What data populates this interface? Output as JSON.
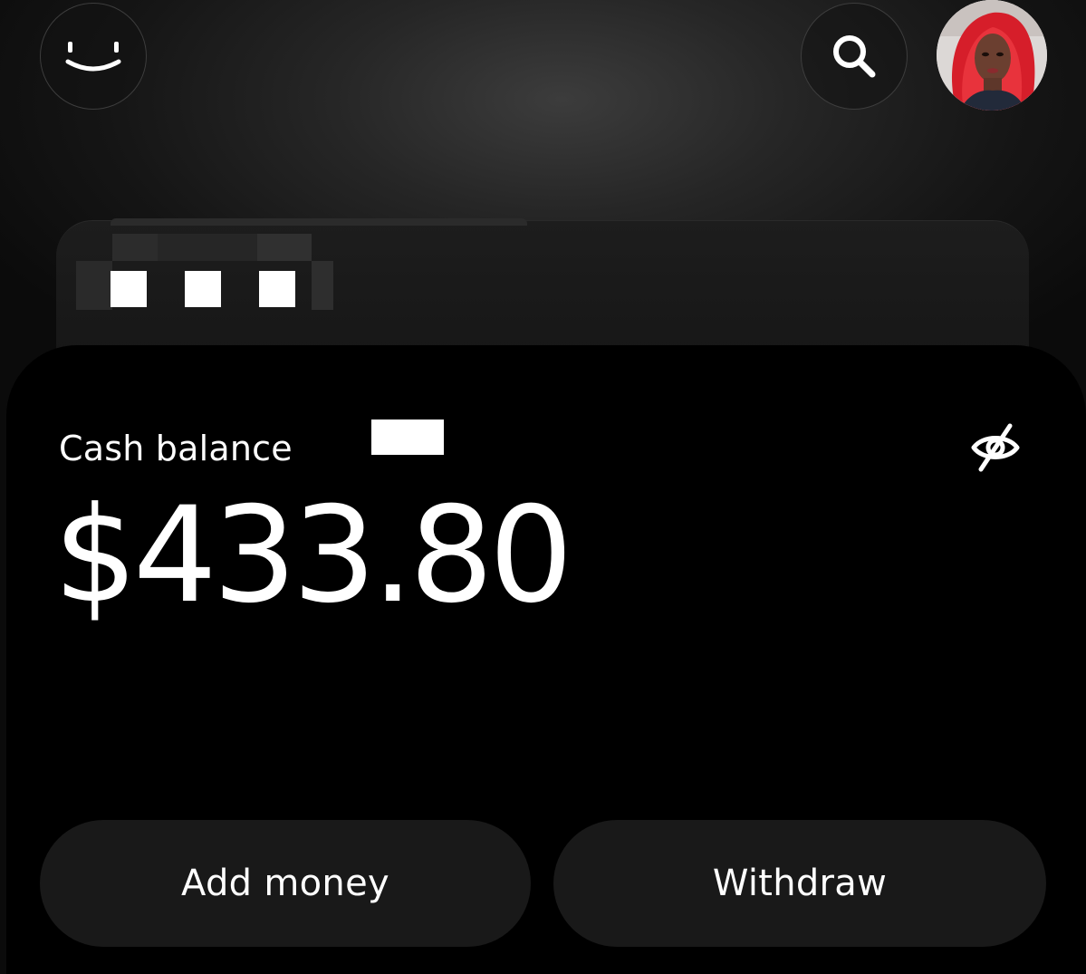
{
  "header": {
    "profile_button_icon": "smiley-face-icon",
    "search_button_icon": "search-icon",
    "avatar": {
      "kind": "user-photo"
    }
  },
  "card_preview": {
    "masked_dots": 3
  },
  "balance_card": {
    "label": "Cash balance",
    "amount": "$433.80",
    "visibility_icon": "eye-off-icon"
  },
  "actions": {
    "add_money_label": "Add money",
    "withdraw_label": "Withdraw"
  },
  "colors": {
    "background": "#0b0b0b",
    "card": "#000000",
    "button": "#191919",
    "text": "#ffffff",
    "avatar_hair": "#e0202a"
  }
}
